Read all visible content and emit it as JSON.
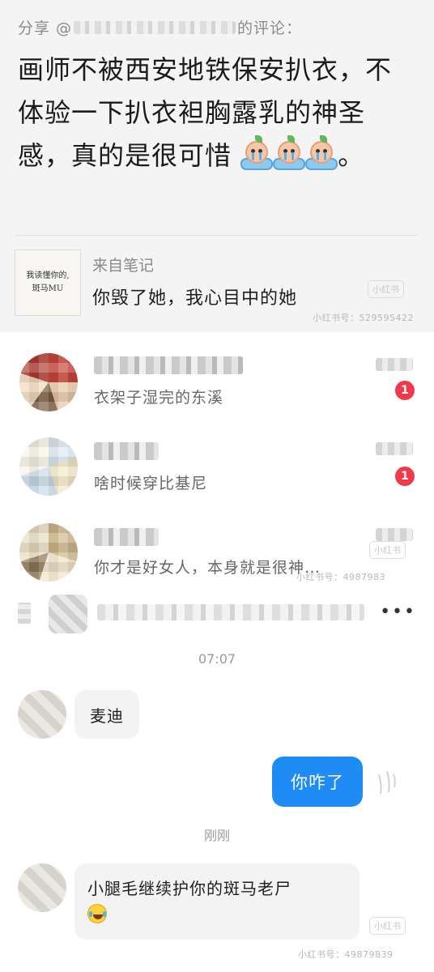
{
  "share_card": {
    "header_prefix": "分享 @",
    "header_suffix": "的评论：",
    "comment_text": "画师不被西安地铁保安扒衣，不体验一下扒衣袒胸露乳的神圣感，真的是很可惜",
    "comment_end": "。",
    "emoji": "crying-baby-in-tub-emoji",
    "note_thumb_text": "我读懂你的,\n斑马MU",
    "note_source": "来自笔记",
    "note_title": "你毁了她，我心目中的她"
  },
  "watermarks": {
    "logo": "小红书",
    "id_1": "小红书号：529595422",
    "id_2": "小红书号：4987983",
    "id_3": "小红书号：49879839"
  },
  "chat_list": [
    {
      "preview": "衣架子湿完的东溪",
      "unread": "1"
    },
    {
      "preview": "啥时候穿比基尼",
      "unread": "1"
    },
    {
      "preview": "你才是好女人，本身就是很神…",
      "unread": ""
    }
  ],
  "conversation": {
    "more_label": "•••",
    "timestamp_1": "07:07",
    "msg_1": "麦迪",
    "msg_2": "你咋了",
    "timestamp_2": "刚刚",
    "msg_3": "小腿毛继续护你的斑马老尸"
  },
  "colors": {
    "accent_blue": "#1f8cf5",
    "badge_red": "#f0394b",
    "card_bg": "#f4f4f5"
  }
}
